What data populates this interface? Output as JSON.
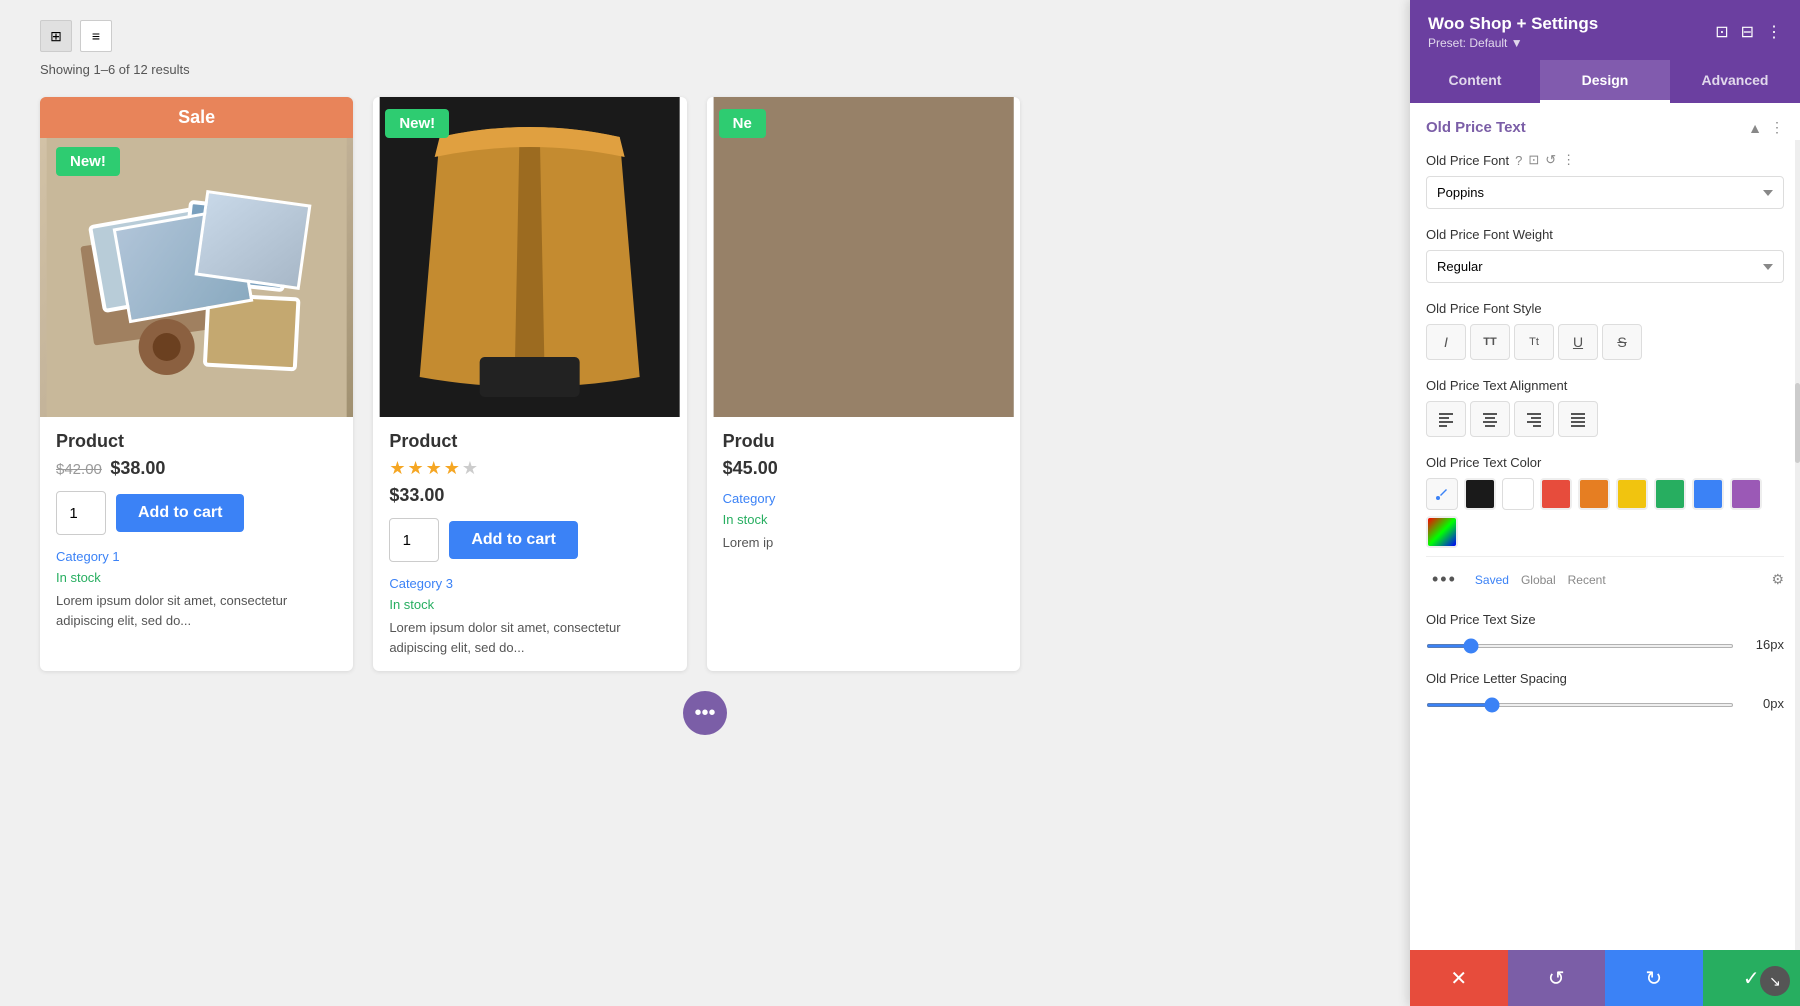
{
  "app": {
    "title": "Woo Shop + Settings",
    "preset": "Preset: Default ▼"
  },
  "header_icons": {
    "responsive": "⊞",
    "layout": "⊟",
    "more": "⋮"
  },
  "tabs": [
    {
      "id": "content",
      "label": "Content"
    },
    {
      "id": "design",
      "label": "Design"
    },
    {
      "id": "advanced",
      "label": "Advanced"
    }
  ],
  "view_controls": {
    "grid_icon": "⊞",
    "list_icon": "≡"
  },
  "results_count": "Showing 1–6 of 12 results",
  "products": [
    {
      "id": 1,
      "title": "Product",
      "sale_banner": "Sale",
      "badge": "New!",
      "old_price": "$42.00",
      "new_price": "$38.00",
      "has_stars": false,
      "qty": "1",
      "add_to_cart": "Add to cart",
      "category": "Category 1",
      "in_stock": "In stock",
      "description": "Lorem ipsum dolor sit amet, consectetur adipiscing elit, sed do..."
    },
    {
      "id": 2,
      "title": "Product",
      "badge": "New!",
      "price": "$33.00",
      "has_stars": true,
      "stars": 4,
      "max_stars": 5,
      "qty": "1",
      "add_to_cart": "Add to cart",
      "category": "Category 3",
      "in_stock": "In stock",
      "description": "Lorem ipsum dolor sit amet, consectetur adipiscing elit, sed do..."
    },
    {
      "id": 3,
      "title": "Produ",
      "badge": "Ne",
      "price": "$45.00",
      "category": "Category",
      "in_stock": "In stock",
      "description": "Lorem ip"
    }
  ],
  "pagination": {
    "dots": "•••"
  },
  "settings": {
    "section_title": "Old Price Text",
    "font_label": "Old Price Font",
    "font_value": "Poppins",
    "font_weight_label": "Old Price Font Weight",
    "font_weight_value": "Regular",
    "font_style_label": "Old Price Font Style",
    "font_styles": [
      "I",
      "TT",
      "Tt",
      "U",
      "S"
    ],
    "alignment_label": "Old Price Text Alignment",
    "alignments": [
      "left",
      "center",
      "right",
      "justify"
    ],
    "color_label": "Old Price Text Color",
    "colors": [
      {
        "name": "black",
        "hex": "#1a1a1a"
      },
      {
        "name": "white",
        "hex": "#ffffff"
      },
      {
        "name": "red",
        "hex": "#e74c3c"
      },
      {
        "name": "orange",
        "hex": "#e67e22"
      },
      {
        "name": "yellow",
        "hex": "#f1c40f"
      },
      {
        "name": "green",
        "hex": "#27ae60"
      },
      {
        "name": "blue",
        "hex": "#3b82f6"
      },
      {
        "name": "purple",
        "hex": "#9b59b6"
      },
      {
        "name": "custom",
        "hex": "custom"
      }
    ],
    "color_tabs": [
      "Saved",
      "Global",
      "Recent"
    ],
    "size_label": "Old Price Text Size",
    "size_value": "16px",
    "size_slider": 16,
    "letter_spacing_label": "Old Price Letter Spacing",
    "letter_spacing_value": "0px",
    "letter_spacing_slider": 0
  },
  "actions": {
    "cancel": "✕",
    "undo": "↺",
    "redo": "↻",
    "confirm": "✓"
  }
}
